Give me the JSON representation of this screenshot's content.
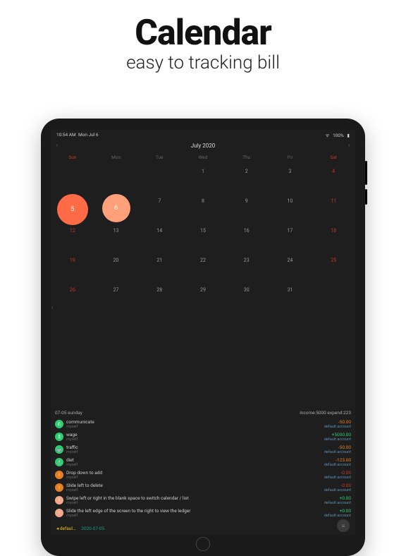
{
  "hero": {
    "title": "Calendar",
    "subtitle": "easy to tracking bill"
  },
  "status": {
    "time": "10:54 AM",
    "date": "Mon Jul 6",
    "wifi": "wifi-icon",
    "battery_pct": "100%"
  },
  "calendar": {
    "title": "July 2020",
    "weekdays": [
      "Sun",
      "Mon",
      "Tue",
      "Wed",
      "Thu",
      "Fri",
      "Sat"
    ],
    "weeks": [
      [
        "",
        "",
        "",
        "1",
        "2",
        "3",
        "4"
      ],
      [
        "5",
        "6",
        "7",
        "8",
        "9",
        "10",
        "11"
      ],
      [
        "12",
        "13",
        "14",
        "15",
        "16",
        "17",
        "18"
      ],
      [
        "19",
        "20",
        "21",
        "22",
        "23",
        "24",
        "25"
      ],
      [
        "26",
        "27",
        "28",
        "29",
        "30",
        "31",
        ""
      ]
    ],
    "highlight_big": 5,
    "highlight_sel": 6
  },
  "list": {
    "header_date": "07-05  sunday",
    "header_summary": "income:5000 expend:223",
    "entries": [
      {
        "icon": "phone-icon",
        "color": "ic-green",
        "title": "communicate",
        "sub": "myself",
        "amt": "-50.00",
        "amtcls": "neg",
        "acct": "default account"
      },
      {
        "icon": "dollar-icon",
        "color": "ic-green",
        "title": "wage",
        "sub": "myself",
        "amt": "+5000.00",
        "amtcls": "pos",
        "acct": "default account"
      },
      {
        "icon": "bus-icon",
        "color": "ic-green",
        "title": "traffic",
        "sub": "myself",
        "amt": "-50.00",
        "amtcls": "neg",
        "acct": "default account"
      },
      {
        "icon": "fork-icon",
        "color": "ic-green",
        "title": "diet",
        "sub": "myself",
        "amt": "-123.00",
        "amtcls": "neg",
        "acct": "default account"
      },
      {
        "icon": "info-icon",
        "color": "ic-orange",
        "title": "Drop down to add",
        "sub": "myself",
        "amt": "-0.00",
        "amtcls": "tiny",
        "acct": "default account"
      },
      {
        "icon": "info-icon",
        "color": "ic-orange",
        "title": "Slide left to delete",
        "sub": "myself",
        "amt": "-0.00",
        "amtcls": "tiny",
        "acct": "default account"
      },
      {
        "icon": "info-icon",
        "color": "ic-peach",
        "title": "Swipe left or right in the blank space to switch calendar / list",
        "sub": "myself",
        "amt": "+0.00",
        "amtcls": "pos",
        "acct": "default account"
      },
      {
        "icon": "info-icon",
        "color": "ic-peach",
        "title": "Slide the left edge of the screen to the right to view the ledger",
        "sub": "myself",
        "amt": "+0.00",
        "amtcls": "pos",
        "acct": "default account"
      }
    ]
  },
  "footer": {
    "ledger": "◂ defaul…",
    "date": "2020-07-05",
    "menu": "≡"
  }
}
